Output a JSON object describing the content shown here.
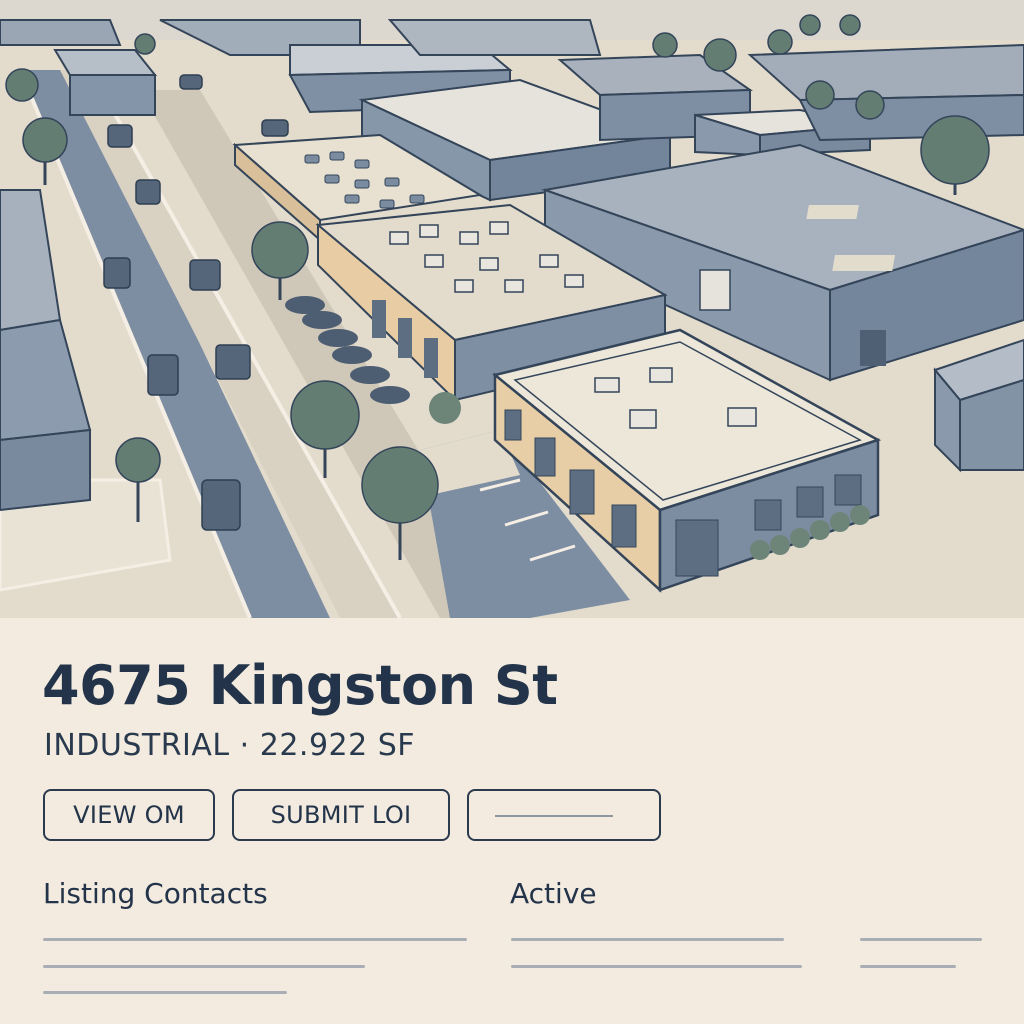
{
  "listing": {
    "address": "4675 Kingston St",
    "subtitle": "INDUSTRIAL · 22.922 SF"
  },
  "actions": {
    "view_om": "VIEW OM",
    "submit_loi": "SUBMIT LOI"
  },
  "sections": {
    "contacts_label": "Listing Contacts",
    "status_label": "Active"
  },
  "colors": {
    "background": "#f3ebdf",
    "text": "#23344a",
    "roof_gray": "#a9b2bc",
    "wall_blue": "#7f8fa3",
    "wall_tan": "#e9cfa6",
    "tree_green": "#5f7a6e"
  },
  "hero_image": "aerial-illustration-industrial-park"
}
